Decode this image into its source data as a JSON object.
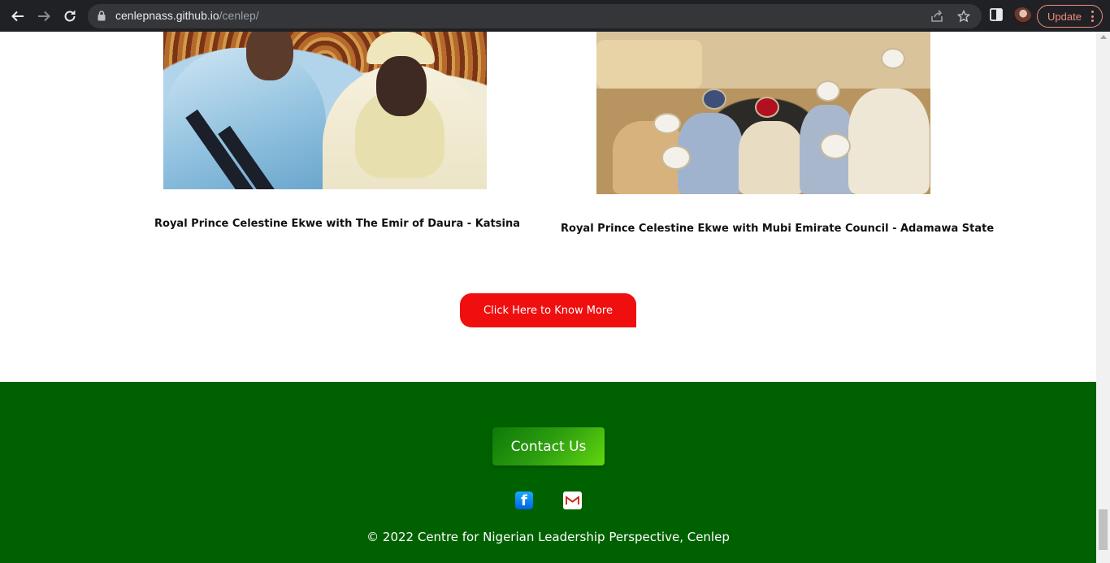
{
  "browser": {
    "url_host": "cenlepnass.github.io",
    "url_path": "/cenlep/",
    "update_label": "Update"
  },
  "gallery": {
    "items": [
      {
        "caption": "Royal Prince Celestine Ekwe with The Emir of Daura - Katsina"
      },
      {
        "caption": "Royal Prince Celestine Ekwe with Mubi Emirate Council - Adamawa State"
      }
    ]
  },
  "cta": {
    "label": "Click Here to Know More",
    "color": "#f00f0f"
  },
  "footer": {
    "contact_label": "Contact Us",
    "copyright": "© 2022 Centre for Nigerian Leadership Perspective, Cenlep",
    "background": "#006100",
    "social": [
      "facebook-icon",
      "gmail-icon"
    ]
  }
}
